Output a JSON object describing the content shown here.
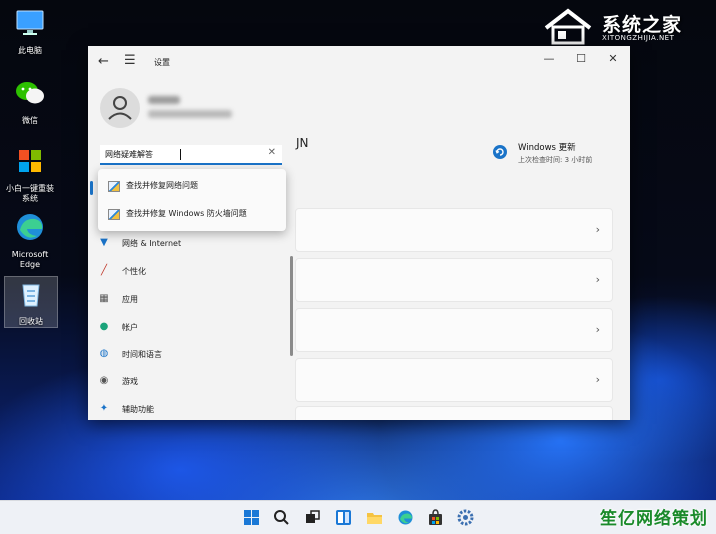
{
  "desktop": {
    "icons": [
      {
        "label": "此电脑",
        "icon": "monitor-icon"
      },
      {
        "label": "微信",
        "icon": "wechat-icon"
      },
      {
        "label": "小白一键重装\n系统",
        "icon": "xiaobai-reinstall-icon"
      },
      {
        "label": "Microsoft\nEdge",
        "icon": "edge-icon"
      },
      {
        "label": "回收站",
        "icon": "recycle-bin-icon"
      }
    ]
  },
  "watermark": {
    "brand": "系统之家",
    "url": "XITONGZHIJIA.NET",
    "bottom_text": "笙亿网络策划"
  },
  "window": {
    "title": "设置",
    "controls": [
      "—",
      "☐",
      "✕"
    ],
    "account_name_suffix": "JN",
    "update": {
      "title": "Windows 更新",
      "subtitle": "上次检查时间: 3 小时前"
    },
    "search": {
      "value": "网络疑难解答",
      "clear": "✕"
    },
    "suggestions": [
      {
        "label": "查找并修复网络问题"
      },
      {
        "label": "查找并修复 Windows 防火墙问题"
      }
    ],
    "nav": [
      {
        "label": "网络 & Internet",
        "icon": "network-icon",
        "color": "#1a73c8"
      },
      {
        "label": "个性化",
        "icon": "brush-icon",
        "color": "#c0392b"
      },
      {
        "label": "应用",
        "icon": "apps-icon",
        "color": "#555555"
      },
      {
        "label": "帐户",
        "icon": "account-icon",
        "color": "#1aa37a"
      },
      {
        "label": "时间和语言",
        "icon": "globe-clock-icon",
        "color": "#1a73c8"
      },
      {
        "label": "游戏",
        "icon": "gamepad-icon",
        "color": "#555555"
      },
      {
        "label": "辅助功能",
        "icon": "accessibility-icon",
        "color": "#1a73c8"
      }
    ],
    "cards_chevron": "›"
  },
  "taskbar": {
    "icons": [
      "start-icon",
      "search-icon",
      "task-view-icon",
      "widgets-icon",
      "file-explorer-icon",
      "edge-icon",
      "store-icon",
      "settings-icon"
    ]
  },
  "colors": {
    "accent": "#1a73c8",
    "window_bg": "#f3f3f3",
    "taskbar_bg": "#eef1f6"
  }
}
